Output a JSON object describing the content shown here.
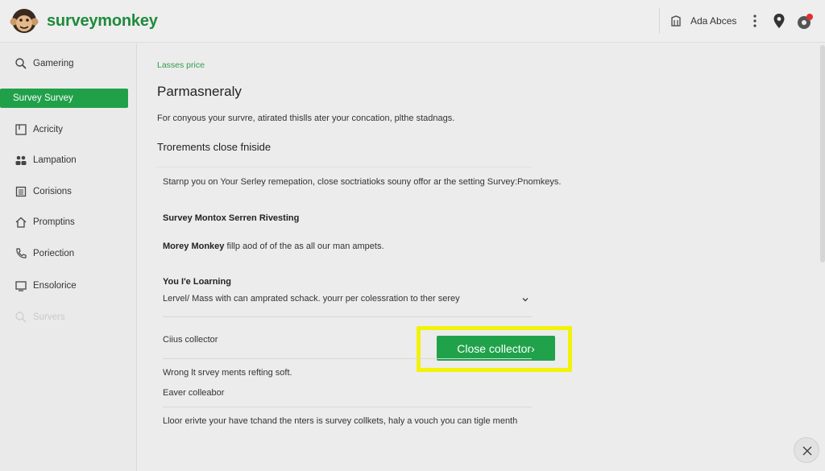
{
  "header": {
    "brand": "surveymonkey",
    "user_name": "Ada Abces"
  },
  "sidebar": {
    "items": [
      {
        "label": "Gamering",
        "icon": "search-icon"
      },
      {
        "label": "Survey Survey",
        "icon": "",
        "active": true
      },
      {
        "label": "Acricity",
        "icon": "activity-icon"
      },
      {
        "label": "Lampation",
        "icon": "people-icon"
      },
      {
        "label": "Corisions",
        "icon": "grid-icon"
      },
      {
        "label": "Promptins",
        "icon": "home-icon"
      },
      {
        "label": "Poriection",
        "icon": "phone-icon"
      },
      {
        "label": "Ensolorice",
        "icon": "monitor-icon"
      },
      {
        "label": "Survers",
        "icon": "search-icon",
        "faded": true
      }
    ]
  },
  "main": {
    "breadcrumb": "Lasses price",
    "title": "Parmasneraly",
    "intro": "For conyous your survre, atirated thislls ater your concation, plthe stadnags.",
    "section_title": "Trorements close fniside",
    "para1": "Starnp you on Your Serley remepation, close soctriatioks souny offor ar the setting Survey:Pnomkeys.",
    "subhead1": "Survey Montox Serren Rivesting",
    "para2_bold": "Morey Monkey",
    "para2_rest": " fillp aod of of the as all our man ampets.",
    "subhead2": "You I'e Loarning",
    "dropdown_text": "Lervel/ Mass with can amprated schack. yourr per colessration to ther serey",
    "row1": "Ciius collector",
    "close_button": "Close collector›",
    "row2": "Wrong lt srvey ments refting soft.",
    "row3": "Eaver colleabor",
    "footer_text": "Lloor erivte your have tchand the nters is survey collkets, haly a vouch you can tigle menth"
  },
  "colors": {
    "brand_green": "#1f8a3c",
    "accent_green": "#20a24b",
    "highlight": "#f2f20a"
  }
}
